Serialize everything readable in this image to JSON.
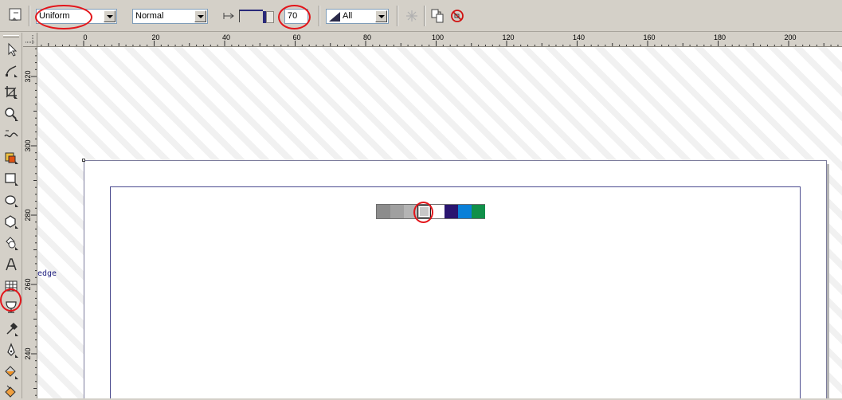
{
  "property_bar": {
    "fill_type": "Uniform",
    "merge_mode": "Normal",
    "transparency_value": "70",
    "target": "All"
  },
  "toolbox": {
    "tools": [
      {
        "name": "pick-tool-icon"
      },
      {
        "name": "shape-tool-icon"
      },
      {
        "name": "crop-tool-icon"
      },
      {
        "name": "zoom-tool-icon"
      },
      {
        "name": "freehand-tool-icon"
      },
      {
        "name": "smart-fill-tool-icon"
      },
      {
        "name": "rectangle-tool-icon"
      },
      {
        "name": "ellipse-tool-icon"
      },
      {
        "name": "polygon-tool-icon"
      },
      {
        "name": "basic-shapes-tool-icon"
      },
      {
        "name": "text-tool-icon"
      },
      {
        "name": "table-tool-icon"
      },
      {
        "name": "interactive-transparency-tool-icon"
      },
      {
        "name": "eyedropper-tool-icon"
      },
      {
        "name": "outline-pen-tool-icon"
      },
      {
        "name": "fill-tool-icon"
      },
      {
        "name": "interactive-fill-tool-icon"
      }
    ]
  },
  "rulers": {
    "horizontal": [
      "0",
      "20",
      "40",
      "60",
      "80",
      "100",
      "120",
      "140",
      "160",
      "180",
      "200"
    ],
    "vertical": [
      "320",
      "300",
      "280",
      "260",
      "240"
    ]
  },
  "canvas": {
    "edge_label": "edge",
    "swatches": [
      "#8c8c8c",
      "#a0a0a0",
      "#b4b4b4",
      "#c8c8c8",
      "#ffffff",
      "#2a1570",
      "#0a80d8",
      "#10904a"
    ]
  }
}
